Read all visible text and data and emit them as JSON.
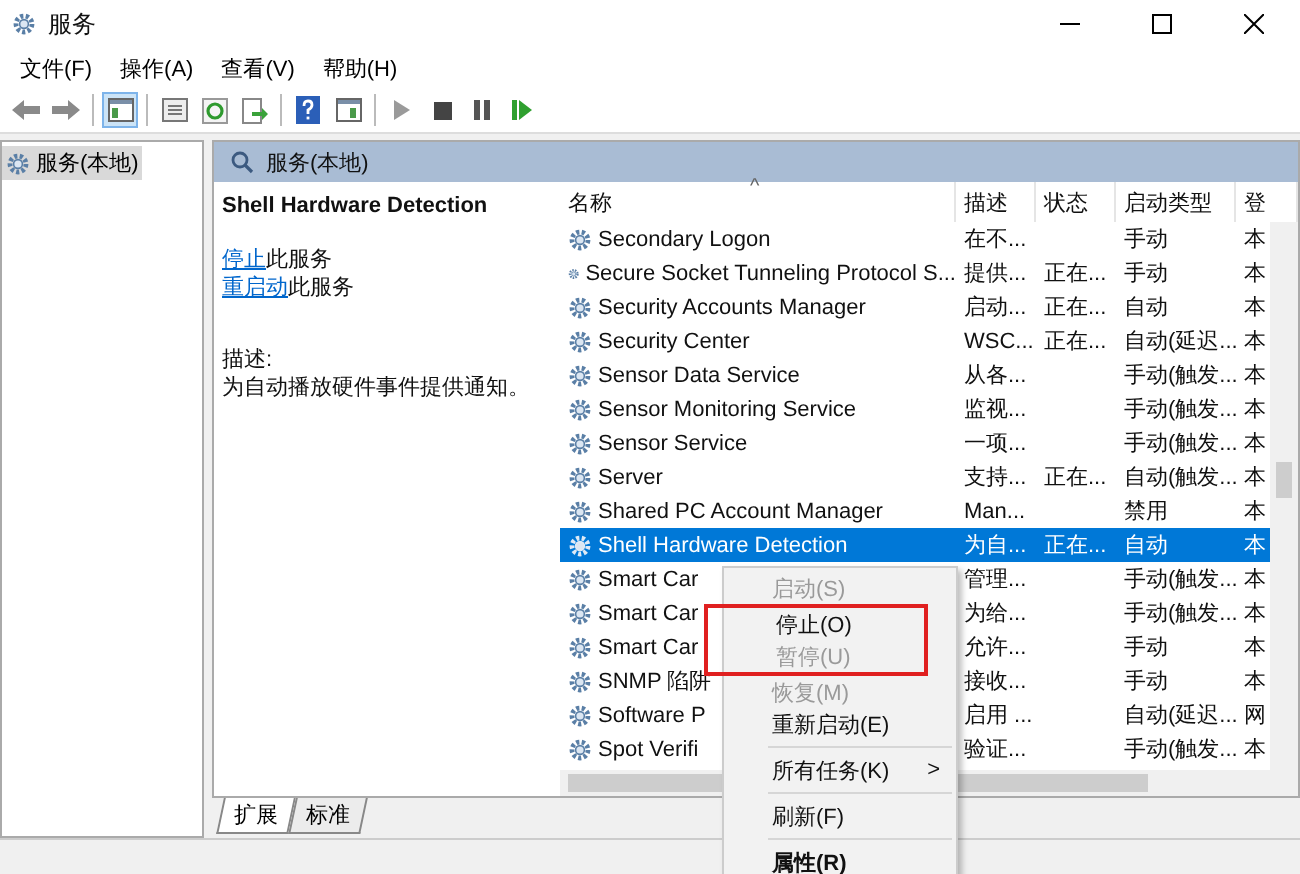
{
  "window": {
    "title": "服务"
  },
  "menu": [
    "文件(F)",
    "操作(A)",
    "查看(V)",
    "帮助(H)"
  ],
  "toolbar": [
    {
      "kind": "back",
      "selected": false
    },
    {
      "kind": "forward",
      "selected": false
    },
    {
      "kind": "sep"
    },
    {
      "kind": "tree",
      "selected": true
    },
    {
      "kind": "sep"
    },
    {
      "kind": "props",
      "selected": false
    },
    {
      "kind": "refresh",
      "selected": false
    },
    {
      "kind": "export",
      "selected": false
    },
    {
      "kind": "sep"
    },
    {
      "kind": "help",
      "selected": false
    },
    {
      "kind": "view",
      "selected": false
    },
    {
      "kind": "sep"
    },
    {
      "kind": "play",
      "selected": false
    },
    {
      "kind": "stop",
      "selected": false
    },
    {
      "kind": "pause",
      "selected": false
    },
    {
      "kind": "resume",
      "selected": false
    }
  ],
  "tree": {
    "label": "服务(本地)",
    "selected": true
  },
  "panel": {
    "title": "服务(本地)"
  },
  "details": {
    "name": "Shell Hardware Detection",
    "actions": [
      {
        "link": "停止",
        "text": "此服务"
      },
      {
        "link": "重启动",
        "text": "此服务"
      }
    ],
    "desc_label": "描述:",
    "desc": "为自动播放硬件事件提供通知。"
  },
  "table": {
    "columns": [
      "名称",
      "描述",
      "状态",
      "启动类型",
      "登"
    ],
    "sort_indicator": "^",
    "rows": [
      {
        "name": "Secondary Logon",
        "desc": "在不...",
        "status": "",
        "startup": "手动",
        "logon": "本",
        "selected": false
      },
      {
        "name": "Secure Socket Tunneling Protocol S...",
        "desc": "提供...",
        "status": "正在...",
        "startup": "手动",
        "logon": "本",
        "selected": false
      },
      {
        "name": "Security Accounts Manager",
        "desc": "启动...",
        "status": "正在...",
        "startup": "自动",
        "logon": "本",
        "selected": false
      },
      {
        "name": "Security Center",
        "desc": "WSC...",
        "status": "正在...",
        "startup": "自动(延迟...",
        "logon": "本",
        "selected": false
      },
      {
        "name": "Sensor Data Service",
        "desc": "从各...",
        "status": "",
        "startup": "手动(触发...",
        "logon": "本",
        "selected": false
      },
      {
        "name": "Sensor Monitoring Service",
        "desc": "监视...",
        "status": "",
        "startup": "手动(触发...",
        "logon": "本",
        "selected": false
      },
      {
        "name": "Sensor Service",
        "desc": "一项...",
        "status": "",
        "startup": "手动(触发...",
        "logon": "本",
        "selected": false
      },
      {
        "name": "Server",
        "desc": "支持...",
        "status": "正在...",
        "startup": "自动(触发...",
        "logon": "本",
        "selected": false
      },
      {
        "name": "Shared PC Account Manager",
        "desc": "Man...",
        "status": "",
        "startup": "禁用",
        "logon": "本",
        "selected": false
      },
      {
        "name": "Shell Hardware Detection",
        "desc": "为自...",
        "status": "正在...",
        "startup": "自动",
        "logon": "本",
        "selected": true
      },
      {
        "name": "Smart Car",
        "desc": "管理...",
        "status": "",
        "startup": "手动(触发...",
        "logon": "本",
        "selected": false
      },
      {
        "name": "Smart Car",
        "desc": "为给...",
        "status": "",
        "startup": "手动(触发...",
        "logon": "本",
        "selected": false
      },
      {
        "name": "Smart Car",
        "desc": "允许...",
        "status": "",
        "startup": "手动",
        "logon": "本",
        "selected": false
      },
      {
        "name": "SNMP 陷阱",
        "desc": "接收...",
        "status": "",
        "startup": "手动",
        "logon": "本",
        "selected": false
      },
      {
        "name": "Software P",
        "desc": "启用 ...",
        "status": "",
        "startup": "自动(延迟...",
        "logon": "网",
        "selected": false
      },
      {
        "name": "Spot Verifi",
        "desc": "验证...",
        "status": "",
        "startup": "手动(触发...",
        "logon": "本",
        "selected": false
      }
    ]
  },
  "tabs": [
    {
      "label": "扩展",
      "selected": true
    },
    {
      "label": "标准",
      "selected": false
    }
  ],
  "context_menu": [
    {
      "kind": "item",
      "label": "启动(S)",
      "disabled": true,
      "highlighted": false
    },
    {
      "kind": "item",
      "label": "停止(O)",
      "disabled": false,
      "highlighted": true
    },
    {
      "kind": "item",
      "label": "暂停(U)",
      "disabled": true,
      "highlighted": true
    },
    {
      "kind": "item",
      "label": "恢复(M)",
      "disabled": true,
      "highlighted": false
    },
    {
      "kind": "item",
      "label": "重新启动(E)",
      "disabled": false,
      "highlighted": false
    },
    {
      "kind": "separator"
    },
    {
      "kind": "submenu",
      "label": "所有任务(K)",
      "arrow": ">",
      "disabled": false,
      "highlighted": false
    },
    {
      "kind": "separator"
    },
    {
      "kind": "item",
      "label": "刷新(F)",
      "disabled": false,
      "highlighted": false
    },
    {
      "kind": "separator"
    },
    {
      "kind": "default",
      "label": "属性(R)",
      "disabled": false,
      "highlighted": false
    }
  ]
}
